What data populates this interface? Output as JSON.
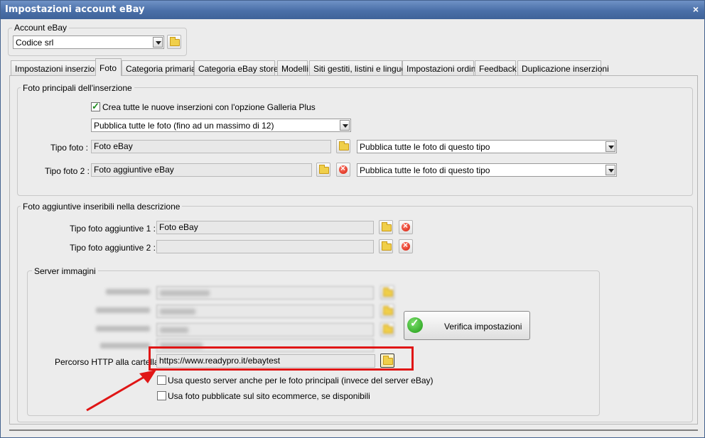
{
  "window": {
    "title": "Impostazioni account eBay",
    "close_glyph": "×"
  },
  "account": {
    "legend": "Account eBay",
    "value": "Codice srl"
  },
  "tabs": [
    {
      "label": "Impostazioni inserzioni"
    },
    {
      "label": "Foto"
    },
    {
      "label": "Categoria primaria"
    },
    {
      "label": "Categoria eBay store"
    },
    {
      "label": "Modelli"
    },
    {
      "label": "Siti gestiti, listini e lingue"
    },
    {
      "label": "Impostazioni ordini"
    },
    {
      "label": "Feedback"
    },
    {
      "label": "Duplicazione inserzioni"
    }
  ],
  "main_photos": {
    "legend": "Foto principali dell'inserzione",
    "gallery_plus_label": "Crea tutte le nuove inserzioni con l'opzione Galleria Plus",
    "gallery_plus_checked": true,
    "publish_select": "Pubblica tutte le foto (fino ad un massimo di 12)",
    "tipo_foto_label": "Tipo foto :",
    "tipo_foto_value": "Foto eBay",
    "tipo_foto_select": "Pubblica tutte le foto di questo tipo",
    "tipo_foto2_label": "Tipo foto 2 :",
    "tipo_foto2_value": "Foto aggiuntive eBay",
    "tipo_foto2_select": "Pubblica tutte le foto di questo tipo"
  },
  "extra_photos": {
    "legend": "Foto aggiuntive inseribili nella descrizione",
    "tipo1_label": "Tipo foto aggiuntive 1 :",
    "tipo1_value": "Foto eBay",
    "tipo2_label": "Tipo foto aggiuntive 2 :",
    "tipo2_value": ""
  },
  "server": {
    "legend": "Server immagini",
    "verify_button": "Verifica impostazioni",
    "http_label": "Percorso HTTP alla cartella",
    "http_value": "https://www.readypro.it/ebaytest",
    "use_server_label": "Usa questo server anche per le foto principali (invece del server eBay)",
    "use_server_checked": false,
    "use_site_label": "Usa foto pubblicate sul sito ecommerce, se disponibili",
    "use_site_checked": false
  },
  "colors": {
    "titlebar": "#4a6fa8",
    "highlight": "#e01616",
    "accent_check": "#1b8a1b"
  },
  "icons": [
    "folder-icon",
    "delete-icon",
    "check-icon",
    "arrow-annotation"
  ]
}
